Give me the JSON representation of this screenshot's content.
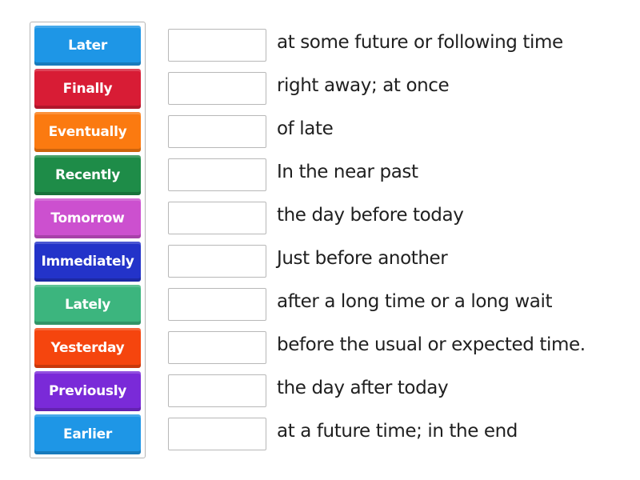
{
  "cards": [
    {
      "label": "Later",
      "color": "#1e96e6"
    },
    {
      "label": "Finally",
      "color": "#d81c35"
    },
    {
      "label": "Eventually",
      "color": "#fb7a10"
    },
    {
      "label": "Recently",
      "color": "#1e8c48"
    },
    {
      "label": "Tomorrow",
      "color": "#cc50cf"
    },
    {
      "label": "Immediately",
      "color": "#2333c9"
    },
    {
      "label": "Lately",
      "color": "#3cb57e"
    },
    {
      "label": "Yesterday",
      "color": "#f5450e"
    },
    {
      "label": "Previously",
      "color": "#7a2ad8"
    },
    {
      "label": "Earlier",
      "color": "#1e96e6"
    }
  ],
  "definitions": [
    "at some future or following time",
    "right away; at once",
    "of late",
    "In the near past",
    "the day before today",
    "Just before another",
    "after a long time or a long wait",
    "before the usual or expected time.",
    "the day after today",
    "at a future time; in the end"
  ]
}
